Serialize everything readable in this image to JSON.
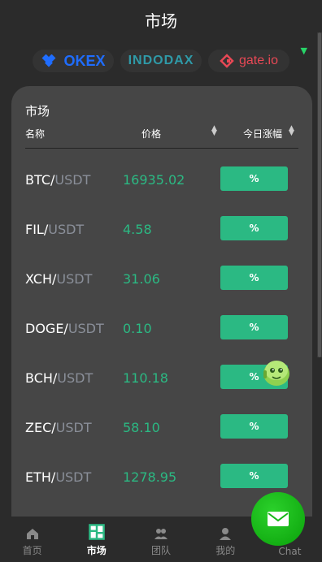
{
  "header": {
    "title": "市场"
  },
  "exchanges": [
    {
      "name": "OKEX"
    },
    {
      "name": "INDODAX"
    },
    {
      "name": "gate.io"
    }
  ],
  "market": {
    "title": "市场",
    "columns": {
      "name": "名称",
      "price": "价格",
      "change": "今日涨幅"
    },
    "rows": [
      {
        "base": "BTC/",
        "quote": "USDT",
        "price": "16935.02",
        "change": "%"
      },
      {
        "base": "FIL/",
        "quote": "USDT",
        "price": "4.58",
        "change": "%"
      },
      {
        "base": "XCH/",
        "quote": "USDT",
        "price": "31.06",
        "change": "%"
      },
      {
        "base": "DOGE/",
        "quote": "USDT",
        "price": "0.10",
        "change": "%"
      },
      {
        "base": "BCH/",
        "quote": "USDT",
        "price": "110.18",
        "change": "%"
      },
      {
        "base": "ZEC/",
        "quote": "USDT",
        "price": "58.10",
        "change": "%"
      },
      {
        "base": "ETH/",
        "quote": "USDT",
        "price": "1278.95",
        "change": "%"
      }
    ]
  },
  "nav": {
    "home": "首页",
    "market": "市场",
    "team": "团队",
    "mine": "我的",
    "chat": "Chat"
  },
  "colors": {
    "accent": "#2bb983",
    "chat_green": "#18b818",
    "background": "#2b2b2b",
    "card": "#464646"
  }
}
